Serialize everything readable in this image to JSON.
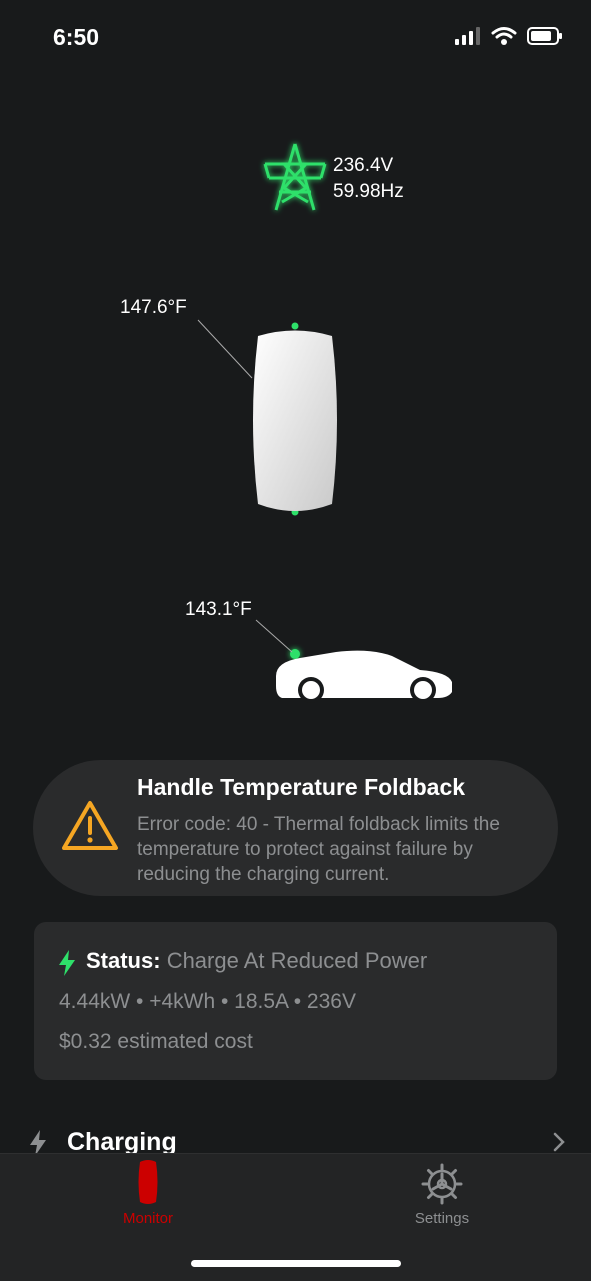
{
  "status_bar": {
    "time": "6:50"
  },
  "diagram": {
    "grid_voltage": "236.4V",
    "grid_frequency": "59.98Hz",
    "charger_temp": "147.6°F",
    "handle_temp": "143.1°F"
  },
  "alert": {
    "title": "Handle Temperature Foldback",
    "body": "Error code: 40 - Thermal foldback limits the temperature to protect against failure by reducing the charging current."
  },
  "status_card": {
    "label": "Status:",
    "value": "Charge At Reduced Power",
    "metrics": "4.44kW • +4kWh • 18.5A • 236V",
    "cost": "$0.32 estimated cost"
  },
  "section": {
    "label": "Charging"
  },
  "tabs": [
    {
      "label": "Monitor",
      "active": true
    },
    {
      "label": "Settings",
      "active": false
    }
  ],
  "colors": {
    "accent_green": "#2ee06a",
    "active_red": "#cc0000",
    "warning": "#f5a623"
  }
}
